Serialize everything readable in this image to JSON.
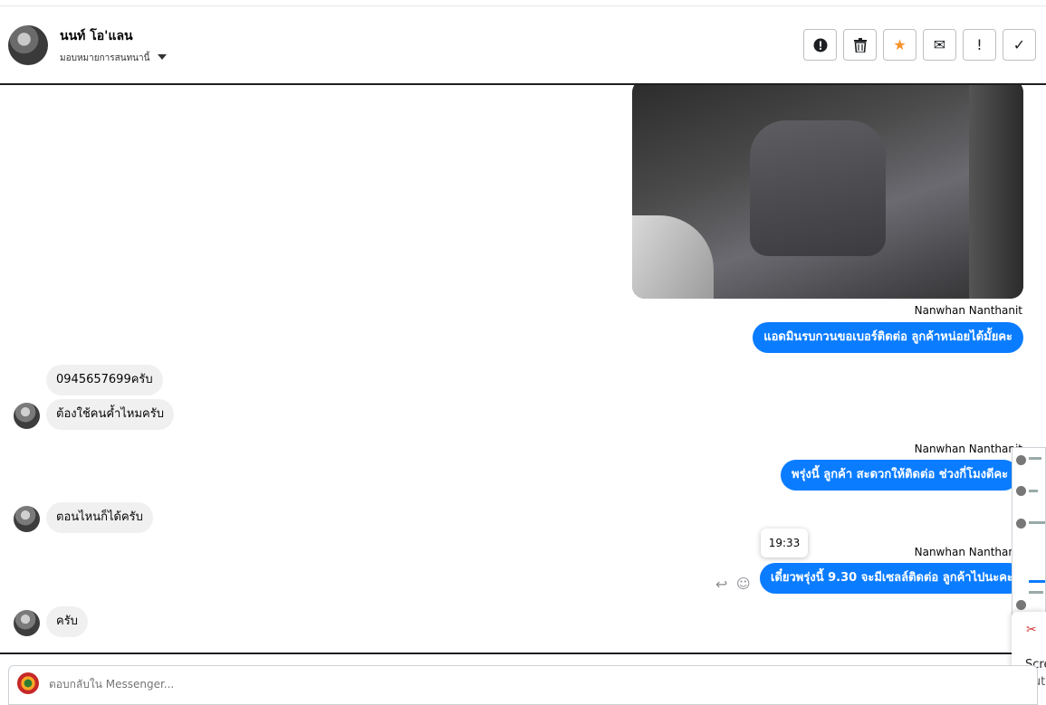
{
  "header": {
    "name": "นนท์ โอ'แลน",
    "assign_label": "มอบหมายการสนทนานี้",
    "actions": [
      {
        "icon": "alert-circle-icon",
        "glyph": "!"
      },
      {
        "icon": "trash-icon",
        "glyph": "🗑"
      },
      {
        "icon": "star-icon",
        "glyph": "★"
      },
      {
        "icon": "mail-icon",
        "glyph": "✉"
      },
      {
        "icon": "exclamation-icon",
        "glyph": "!"
      },
      {
        "icon": "check-icon",
        "glyph": "✓"
      }
    ]
  },
  "messages": {
    "sender_1": "Nanwhan Nanthanit",
    "out_1": "แอดมินรบกวนขอเบอร์ติดต่อ ลูกค้าหน่อยได้มั้ยคะ",
    "in_1": "0945657699ครับ",
    "in_2": "ต้องใช้คนค้ำไหมครับ",
    "sender_2": "Nanwhan Nanthanit",
    "out_2": "พรุ่งนี้ ลูกค้า สะดวกให้ติดต่อ ช่วงกี่โมงดีคะ",
    "in_3": "ตอนไหนก็ได้ครับ",
    "tooltip_time": "19:33",
    "sender_3": "Nanwhan Nanthanit",
    "out_3": "เดี๋ยวพรุ่งนี้ 9.30 จะมีเซลล์ติดต่อ ลูกค้าไปนะคะ",
    "in_4": "ครับ"
  },
  "snip": {
    "line1": "Scre",
    "line2": "Aut"
  },
  "composer": {
    "placeholder": "ตอบกลับใน Messenger..."
  },
  "colors": {
    "outgoing_bubble": "#0a7cff",
    "incoming_bubble": "#f0f0f0",
    "star_accent": "#f7922c"
  }
}
